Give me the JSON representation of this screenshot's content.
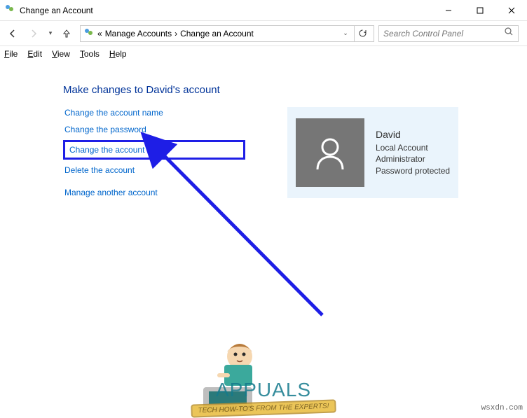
{
  "window": {
    "title": "Change an Account"
  },
  "breadcrumb": {
    "segments": [
      "Manage Accounts",
      "Change an Account"
    ],
    "chevrons": "« ",
    "sep": " ›"
  },
  "search": {
    "placeholder": "Search Control Panel"
  },
  "menu": [
    "File",
    "Edit",
    "View",
    "Tools",
    "Help"
  ],
  "page": {
    "title": "Make changes to David's account",
    "actions": {
      "change_name": "Change the account name",
      "change_password": "Change the password",
      "change_type": "Change the account type",
      "delete": "Delete the account",
      "manage_another": "Manage another account"
    }
  },
  "account": {
    "name": "David",
    "type": "Local Account",
    "role": "Administrator",
    "protection": "Password protected"
  },
  "watermark": {
    "brand": "APPUALS",
    "tagline": "TECH HOW-TO'S FROM THE EXPERTS!",
    "url": "wsxdn.com"
  }
}
